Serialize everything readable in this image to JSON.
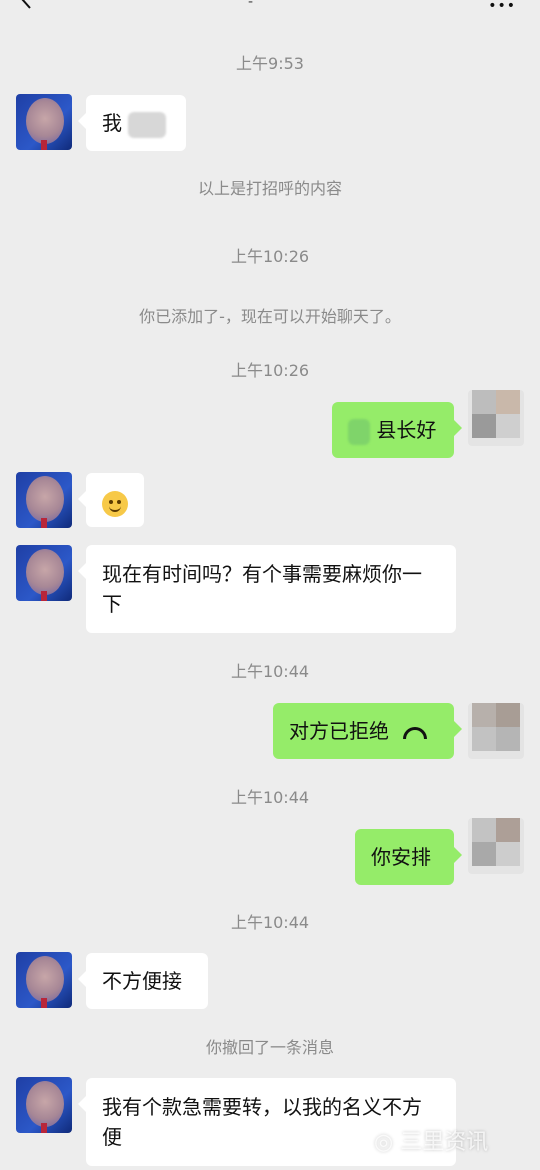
{
  "header": {
    "back_icon": "chevron-left-icon",
    "title_fragment": "-",
    "more_label": "•••"
  },
  "messages": {
    "ts1": "上午9:53",
    "m1_text": "我",
    "sys1": "以上是打招呼的内容",
    "ts2": "上午10:26",
    "sys2": "你已添加了-，现在可以开始聊天了。",
    "ts3": "上午10:26",
    "m2_text": "县长好",
    "m3_emoji": "smile-emoji",
    "m4_text": "现在有时间吗？有个事需要麻烦你一下",
    "ts4": "上午10:44",
    "m5_text": "对方已拒绝",
    "ts5": "上午10:44",
    "m6_text": "你安排",
    "ts6": "上午10:44",
    "m7_text": "不方便接",
    "sys3": "你撤回了一条消息",
    "m8_text": "我有个款急需要转，以我的名义不方便"
  },
  "watermark": "◎ 三里资讯"
}
